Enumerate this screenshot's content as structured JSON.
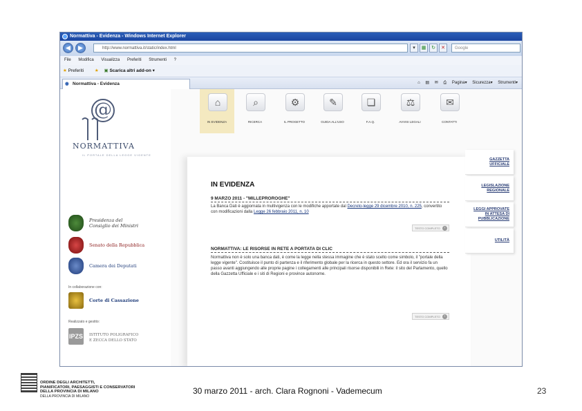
{
  "browser": {
    "title": "Normattiva - Evidenza - Windows Internet Explorer",
    "address": "http://www.normattiva.it/static/index.html",
    "search_placeholder": "Google",
    "menu": [
      "File",
      "Modifica",
      "Visualizza",
      "Preferiti",
      "Strumenti",
      "?"
    ],
    "favorites_label": "Preferiti",
    "addons_label": "Scarica altri add-on",
    "tab_label": "Normattiva - Evidenza",
    "tools": [
      "Pagina",
      "Sicurezza",
      "Strumenti"
    ]
  },
  "site": {
    "logo_name": "NORMATTIVA",
    "logo_sub": "IL PORTALE DELLA LEGGE VIGENTE",
    "institutions": [
      {
        "line1": "Presidenza del",
        "line2": "Consiglio dei Ministri",
        "color": "#333333"
      },
      {
        "line1": "Senato della Repubblica",
        "line2": "",
        "color": "#8b1a1a"
      },
      {
        "line1": "Camera dei Deputati",
        "line2": "",
        "color": "#1f3c7a"
      }
    ],
    "collab_label": "In collaborazione con:",
    "cassazione": "Corte di Cassazione",
    "realized_label": "Realizzato e gestito:",
    "ipzs_line1": "ISTITUTO POLIGRAFICO",
    "ipzs_line2": "E ZECCA DELLO STATO",
    "nav": [
      {
        "label": "IN EVIDENZA",
        "icon": "home-icon",
        "glyph": "⌂"
      },
      {
        "label": "RICERCA",
        "icon": "magnifier-icon",
        "glyph": "⌕"
      },
      {
        "label": "IL PROGETTO",
        "icon": "gears-icon",
        "glyph": "⚙"
      },
      {
        "label": "GUIDA ALL'USO",
        "icon": "document-icon",
        "glyph": "✎"
      },
      {
        "label": "F.A.Q.",
        "icon": "folder-icon",
        "glyph": "❏"
      },
      {
        "label": "AVVISI LEGALI",
        "icon": "scales-icon",
        "glyph": "⚖"
      },
      {
        "label": "CONTATTI",
        "icon": "envelope-icon",
        "glyph": "✉"
      }
    ],
    "panel_title": "IN EVIDENZA",
    "article1": {
      "title": "9 MARZO 2011 - \"MILLEPROROGHE\"",
      "body_a": "La Banca Dati è aggiornata in multivigenza con le modifiche apportate dal ",
      "link1": "Decreto-legge 29 dicembre 2010, n. 225",
      "body_b": ", convertito con modificazioni dalla ",
      "link2": "Legge 26 febbraio 2011, n. 10",
      "more": "TESTO COMPLETO"
    },
    "article2": {
      "title": "NORMATTIVA: LE RISORSE IN RETE A PORTATA DI CLIC",
      "body": "Normattiva non è solo una banca dati, è come la legge nella stessa immagine che è stato scelto come simbolo, il \"portale della legge vigente\". Costituisce il punto di partenza e il riferimento globale per la ricerca in questo settore. Ed ora il servizio fa un passo avanti aggiungendo alle proprie pagine i collegamenti alle principali risorse disponibili in Rete: il sito del Parlamento, quello della Gazzetta Ufficiale e i siti di Regioni e province autonome.",
      "more": "TESTO COMPLETO"
    },
    "right_tabs": [
      {
        "line1": "GAZZETTA",
        "line2": "UFFICIALE",
        "line3": ""
      },
      {
        "line1": "LEGISLAZIONE",
        "line2": "REGIONALE",
        "line3": ""
      },
      {
        "line1": "LEGGI APPROVATE",
        "line2": "IN ATTESA DI",
        "line3": "PUBBLICAZIONE"
      },
      {
        "line1": "UTILITÀ",
        "line2": "",
        "line3": ""
      }
    ]
  },
  "slide": {
    "org_line1": "ORDINE DEGLI ARCHITETTI,",
    "org_line2": "PIANIFICATORI, PAESAGGISTI E CONSERVATORI",
    "org_line3": "DELLA PROVINCIA DI MILANO",
    "org_line4": "DELLA PROVINCIA DI MILANO",
    "footer_title": "30 marzo 2011 - arch. Clara Rognoni - Vademecum",
    "page_number": "23"
  }
}
